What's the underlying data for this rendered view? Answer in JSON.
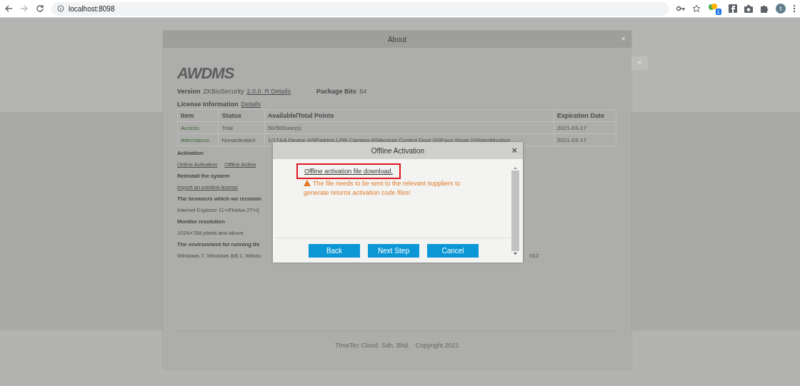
{
  "browser": {
    "url": "localhost:8098",
    "extension_badge": "1",
    "avatar": "t"
  },
  "about": {
    "title": "About",
    "close": "×",
    "logo": "AWDMS",
    "version_label": "Version",
    "version_value": "ZKBioSecurity",
    "version_link": "2.0.0_R Details",
    "package_label": "Package Bits",
    "package_value": "64",
    "license_label": "License Information",
    "license_link": "Details",
    "table": {
      "columns": [
        "Item",
        "Status",
        "Available/Total Points",
        "Expiration Date"
      ],
      "rows": [
        [
          "Access",
          "Trial",
          "50/50Door(s)",
          "2021-03-17"
        ],
        [
          "Attendance",
          "Nonactivated",
          "1/1T&A Device  0/0Parking LPR Camera  0/0Access Control Door  0/0Face Kiosk  0/0Identification",
          "2021-03-17"
        ]
      ]
    },
    "sections": [
      {
        "kind": "heading",
        "text": "Activation"
      },
      {
        "kind": "links",
        "items": [
          "Online Activation",
          "Offline Activa"
        ]
      },
      {
        "kind": "heading",
        "text": "Reinstall the system"
      },
      {
        "kind": "links",
        "items": [
          "Import an existing license"
        ]
      },
      {
        "kind": "heading",
        "text": "The browsers which we recomm"
      },
      {
        "kind": "text",
        "text": "Internet Explorer 11+/Firefox 27+/("
      },
      {
        "kind": "heading",
        "text": "Monitor resolution"
      },
      {
        "kind": "text",
        "text": "1024×768 pixels and above"
      },
      {
        "kind": "heading",
        "text": "The environment for running thi"
      },
      {
        "kind": "text",
        "text": "Windows 7, Windows 8/8.1, Windo",
        "tail": "012"
      }
    ],
    "footer": [
      "TimeTec Cloud. Sdn. Bhd.",
      "Copyright 2021"
    ]
  },
  "dialog": {
    "title": "Offline Activation",
    "close": "×",
    "link": "Offline activation file download.",
    "warning": "The file needs to be sent to the relevant suppliers to generate returns activation code files!",
    "buttons": [
      "Back",
      "Next Step",
      "Cancel"
    ]
  }
}
